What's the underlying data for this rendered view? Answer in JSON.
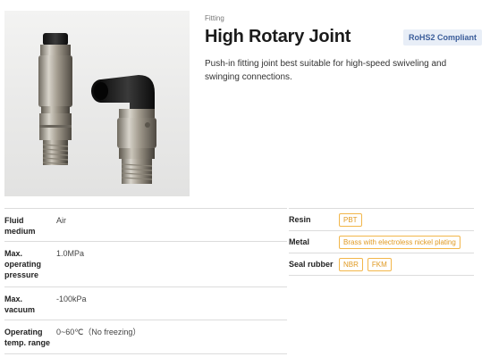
{
  "product": {
    "category": "Fitting",
    "title": "High Rotary Joint",
    "badge": "RoHS2 Compliant",
    "description": "Push-in fitting joint best suitable for high-speed swiveling and swinging connections."
  },
  "specs": [
    {
      "label": "Fluid medium",
      "value": "Air"
    },
    {
      "label": "Max. operating pressure",
      "value": "1.0MPa"
    },
    {
      "label": "Max. vacuum",
      "value": "-100kPa"
    },
    {
      "label": "Operating temp. range",
      "value": "0~60℃（No freezing）"
    }
  ],
  "materials": [
    {
      "label": "Resin",
      "tags": [
        "PBT"
      ]
    },
    {
      "label": "Metal",
      "tags": [
        "Brass with electroless nickel plating"
      ]
    },
    {
      "label": "Seal rubber",
      "tags": [
        "NBR",
        "FKM"
      ]
    }
  ],
  "colors": {
    "badge_bg": "#e8eef7",
    "badge_text": "#3b5d9a",
    "tag_border": "#f2b64a",
    "tag_text": "#e09a23"
  }
}
